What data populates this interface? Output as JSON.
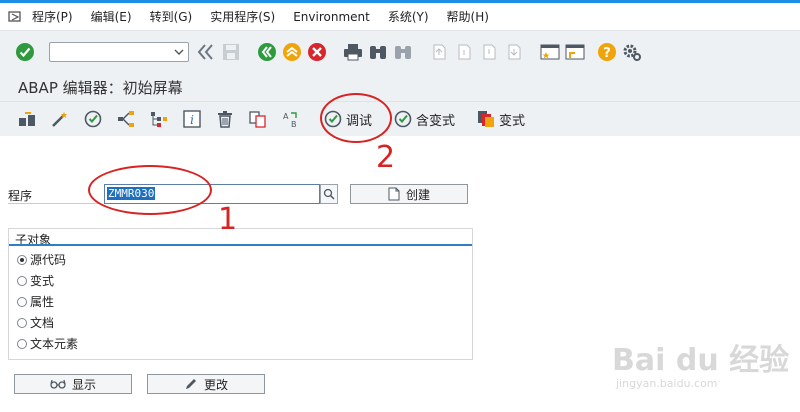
{
  "menu": [
    "程序(P)",
    "编辑(E)",
    "转到(G)",
    "实用程序(S)",
    "Environment",
    "系统(Y)",
    "帮助(H)"
  ],
  "title": "ABAP 编辑器：初始屏幕",
  "toolbar": {
    "debug_label": "调试",
    "with_variant_label": "含变式",
    "variant_label": "变式"
  },
  "program": {
    "label": "程序",
    "value": "ZMMR030",
    "create_label": "创建"
  },
  "subobjects": {
    "title": "子对象",
    "options": [
      "源代码",
      "变式",
      "属性",
      "文档",
      "文本元素"
    ],
    "selected_index": 0
  },
  "buttons": {
    "display_label": "显示",
    "change_label": "更改"
  },
  "annotations": [
    "1",
    "2"
  ],
  "watermark": {
    "main": "Bai du 经验",
    "sub": "jingyan.baidu.com"
  },
  "colors": {
    "accent": "#1b8de4",
    "annotation": "#d82323",
    "toolbar_bg": "#eef1f4"
  }
}
